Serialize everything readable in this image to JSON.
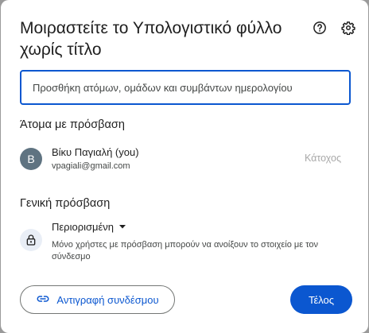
{
  "dialog": {
    "title": "Μοιραστείτε το Υπολογιστικό φύλλο χωρίς τίτλο",
    "icons": {
      "help": "help-circle-icon",
      "settings": "gear-icon"
    }
  },
  "add_people": {
    "placeholder": "Προσθήκη ατόμων, ομάδων και συμβάντων ημερολογίου",
    "value": ""
  },
  "people_with_access": {
    "title": "Άτομα με πρόσβαση",
    "people": [
      {
        "avatar_letter": "B",
        "name": "Βίκυ Παγιαλή (you)",
        "email": "vpagiali@gmail.com",
        "role": "Κάτοχος"
      }
    ]
  },
  "general_access": {
    "title": "Γενική πρόσβαση",
    "selected": "Περιορισμένη",
    "description": "Μόνο χρήστες με πρόσβαση μπορούν να ανοίξουν το στοιχείο με τον σύνδεσμο",
    "icon": "lock-icon"
  },
  "footer": {
    "copy_link_label": "Αντιγραφή συνδέσμου",
    "done_label": "Τέλος"
  },
  "colors": {
    "accent": "#0b57d0",
    "avatar_bg": "#5f7381",
    "lock_bg": "#e9eef6"
  }
}
